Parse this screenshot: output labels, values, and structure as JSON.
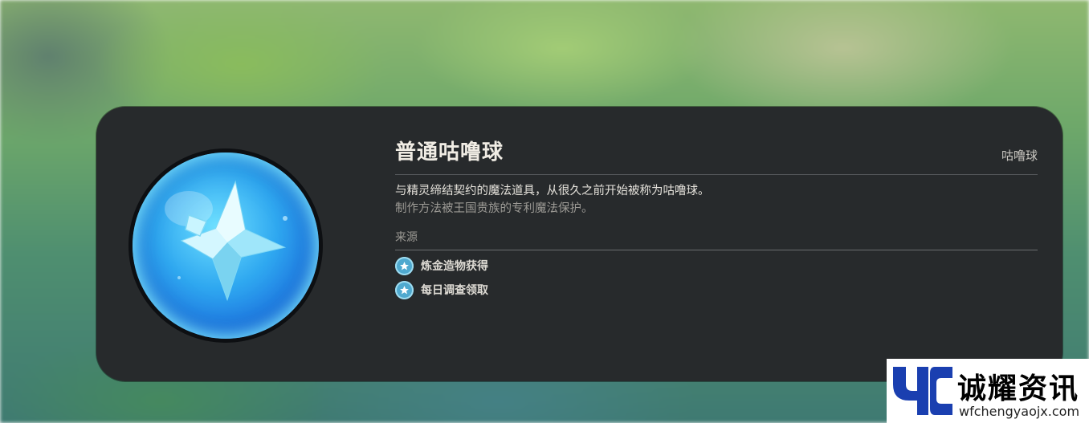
{
  "item": {
    "name": "普通咕噜球",
    "type": "咕噜球",
    "description_line1": "与精灵缔结契约的魔法道具，从很久之前开始被称为咕噜球。",
    "description_line2": "制作方法被王国贵族的专利魔法保护。",
    "icon": "star-in-blue-orb",
    "colors": {
      "card": "#272a2c",
      "orb": "#2fa8f0",
      "source_icon": "#4fa9cf"
    }
  },
  "source": {
    "label": "来源",
    "items": [
      {
        "text": "炼金造物获得",
        "icon": "star-badge-icon"
      },
      {
        "text": "每日调查领取",
        "icon": "star-badge-icon"
      }
    ]
  },
  "watermark": {
    "title": "诚耀资讯",
    "url": "wfchengyaojx.com"
  }
}
